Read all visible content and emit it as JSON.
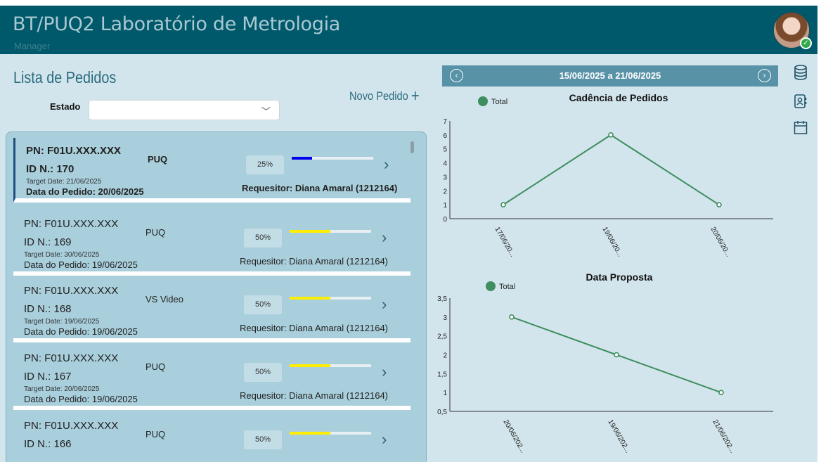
{
  "header": {
    "title": "BT/PUQ2 Laboratório de Metrologia",
    "subtitle": "Manager"
  },
  "list": {
    "title": "Lista de Pedidos",
    "new_button": "Novo Pedido",
    "filter_label": "Estado",
    "filter_value": "",
    "items": [
      {
        "pn": "PN: F01U.XXX.XXX",
        "id": "ID N.: 170",
        "target": "Target Date: 21/06/2025",
        "date": "Data do Pedido: 20/06/2025",
        "type": "PUQ",
        "progress_label": "25%",
        "progress": 0.25,
        "bar_color": "#0000ee",
        "requester": "Requesitor: Diana Amaral (1212164)"
      },
      {
        "pn": "PN: F01U.XXX.XXX",
        "id": "ID N.: 169",
        "target": "Target Date: 30/06/2025",
        "date": "Data do Pedido: 19/06/2025",
        "type": "PUQ",
        "progress_label": "50%",
        "progress": 0.5,
        "bar_color": "#ffee00",
        "requester": "Requesitor: Diana Amaral (1212164)"
      },
      {
        "pn": "PN: F01U.XXX.XXX",
        "id": "ID N.: 168",
        "target": "Target Date: 19/06/2025",
        "date": "Data do Pedido: 19/06/2025",
        "type": "VS Video",
        "progress_label": "50%",
        "progress": 0.5,
        "bar_color": "#ffee00",
        "requester": "Requesitor: Diana Amaral (1212164)"
      },
      {
        "pn": "PN: F01U.XXX.XXX",
        "id": "ID N.: 167",
        "target": "Target Date: 20/06/2025",
        "date": "Data do Pedido: 19/06/2025",
        "type": "PUQ",
        "progress_label": "50%",
        "progress": 0.5,
        "bar_color": "#ffee00",
        "requester": "Requesitor: Diana Amaral (1212164)"
      },
      {
        "pn": "PN: F01U.XXX.XXX",
        "id": "ID N.: 166",
        "target": "",
        "date": "",
        "type": "PUQ",
        "progress_label": "50%",
        "progress": 0.5,
        "bar_color": "#ffee00",
        "requester": ""
      }
    ]
  },
  "date_range": "15/06/2025 a 21/06/2025",
  "side_icons": [
    "database-icon",
    "contact-book-icon",
    "calendar-icon"
  ],
  "colors": {
    "header": "#00596b",
    "line": "#3e8e5f",
    "nav": "#5792a6"
  },
  "chart_data": [
    {
      "type": "line",
      "title": "Cadência de Pedidos",
      "legend": "Total",
      "categories": [
        "17/06/20...",
        "19/06/20...",
        "20/06/20..."
      ],
      "values": [
        1,
        6,
        1
      ],
      "yticks": [
        "0",
        "1",
        "2",
        "3",
        "4",
        "5",
        "6",
        "7"
      ],
      "ylim": [
        0,
        7
      ]
    },
    {
      "type": "line",
      "title": "Data Proposta",
      "legend": "Total",
      "categories": [
        "20/06/202...",
        "19/06/202...",
        "21/06/202..."
      ],
      "values": [
        3,
        2,
        1
      ],
      "yticks": [
        "0,5",
        "1",
        "1,5",
        "2",
        "2,5",
        "3",
        "3,5"
      ],
      "ylim": [
        0.5,
        3.5
      ]
    }
  ]
}
